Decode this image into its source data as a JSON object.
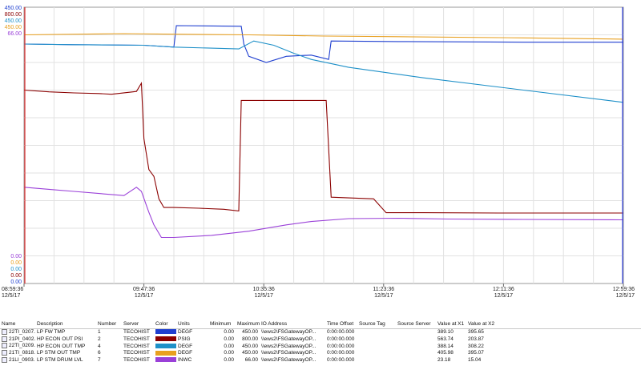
{
  "chart_data": {
    "type": "line",
    "y_axis_labels": [
      {
        "text": "450.00",
        "color": "#1f3fd0",
        "pos": "top"
      },
      {
        "text": "800.00",
        "color": "#8b0000",
        "pos": "top"
      },
      {
        "text": "450.00",
        "color": "#1e90c8",
        "pos": "top"
      },
      {
        "text": "450.00",
        "color": "#e8a020",
        "pos": "top"
      },
      {
        "text": "66.00",
        "color": "#9a40d8",
        "pos": "top"
      },
      {
        "text": "0.00",
        "color": "#9a40d8",
        "pos": "bottom"
      },
      {
        "text": "0.00",
        "color": "#e8a020",
        "pos": "bottom"
      },
      {
        "text": "0.00",
        "color": "#1e90c8",
        "pos": "bottom"
      },
      {
        "text": "0.00",
        "color": "#8b0000",
        "pos": "bottom"
      },
      {
        "text": "0.00",
        "color": "#1f3fd0",
        "pos": "bottom"
      }
    ],
    "x_ticks": [
      {
        "t": 0,
        "time": "08:59:36",
        "date": "12/5/17"
      },
      {
        "t": 48,
        "time": "09:47:36",
        "date": "12/5/17"
      },
      {
        "t": 96,
        "time": "10:35:36",
        "date": "12/5/17"
      },
      {
        "t": 144,
        "time": "11:23:36",
        "date": "12/5/17"
      },
      {
        "t": 192,
        "time": "12:11:36",
        "date": "12/5/17"
      },
      {
        "t": 240,
        "time": "12:59:36",
        "date": "12/5/17"
      }
    ],
    "x_range_minutes": [
      0,
      240
    ],
    "grid": true,
    "series": [
      {
        "tag": "22TI_0207...",
        "color": "#1f3fd0",
        "ymax": 450,
        "points": [
          [
            0,
            390
          ],
          [
            20,
            389
          ],
          [
            48,
            388
          ],
          [
            60,
            385
          ],
          [
            61,
            420
          ],
          [
            87,
            419
          ],
          [
            88,
            390
          ],
          [
            90,
            370
          ],
          [
            97,
            360
          ],
          [
            105,
            370
          ],
          [
            115,
            372
          ],
          [
            122,
            365
          ],
          [
            123,
            395
          ],
          [
            150,
            394
          ],
          [
            200,
            393
          ],
          [
            240,
            393
          ]
        ]
      },
      {
        "tag": "21PI_0402...",
        "color": "#8b0000",
        "ymax": 800,
        "points": [
          [
            0,
            560
          ],
          [
            10,
            555
          ],
          [
            20,
            552
          ],
          [
            30,
            550
          ],
          [
            35,
            548
          ],
          [
            45,
            556
          ],
          [
            47,
            580
          ],
          [
            48,
            420
          ],
          [
            50,
            330
          ],
          [
            52,
            310
          ],
          [
            54,
            245
          ],
          [
            56,
            220
          ],
          [
            60,
            220
          ],
          [
            70,
            218
          ],
          [
            80,
            215
          ],
          [
            86,
            210
          ],
          [
            87,
            530
          ],
          [
            96,
            530
          ],
          [
            110,
            530
          ],
          [
            121,
            530
          ],
          [
            123,
            250
          ],
          [
            140,
            245
          ],
          [
            145,
            205
          ],
          [
            160,
            205
          ],
          [
            190,
            204
          ],
          [
            220,
            204
          ],
          [
            240,
            204
          ]
        ]
      },
      {
        "tag": "22TI_0209...",
        "color": "#1e90c8",
        "ymax": 450,
        "points": [
          [
            0,
            390
          ],
          [
            20,
            389
          ],
          [
            48,
            388
          ],
          [
            60,
            385
          ],
          [
            86,
            382
          ],
          [
            92,
            395
          ],
          [
            100,
            388
          ],
          [
            108,
            375
          ],
          [
            115,
            365
          ],
          [
            130,
            352
          ],
          [
            160,
            335
          ],
          [
            200,
            315
          ],
          [
            240,
            295
          ]
        ]
      },
      {
        "tag": "21TI_0818...",
        "color": "#e8a020",
        "ymax": 450,
        "points": [
          [
            0,
            405
          ],
          [
            40,
            407
          ],
          [
            60,
            406
          ],
          [
            90,
            405
          ],
          [
            120,
            403
          ],
          [
            150,
            402
          ],
          [
            200,
            400
          ],
          [
            240,
            398
          ]
        ]
      },
      {
        "tag": "21LI_0903...",
        "color": "#9a40d8",
        "ymax": 66,
        "points": [
          [
            0,
            23
          ],
          [
            10,
            22.5
          ],
          [
            20,
            22
          ],
          [
            30,
            21.5
          ],
          [
            40,
            21
          ],
          [
            45,
            23
          ],
          [
            47,
            22
          ],
          [
            50,
            17
          ],
          [
            52,
            14
          ],
          [
            55,
            11
          ],
          [
            60,
            11
          ],
          [
            75,
            11.5
          ],
          [
            90,
            12.5
          ],
          [
            105,
            14
          ],
          [
            115,
            14.8
          ],
          [
            130,
            15.5
          ],
          [
            150,
            15.6
          ],
          [
            170,
            15.4
          ],
          [
            200,
            15.3
          ],
          [
            240,
            15.2
          ]
        ]
      }
    ]
  },
  "table": {
    "columns": [
      "Name",
      "Description",
      "Number",
      "Server",
      "Color",
      "Units",
      "Minimum",
      "Maximum",
      "IO Address",
      "Time Offset",
      "Source Tag",
      "Source Server",
      "Value at X1",
      "Value at X2"
    ],
    "rows": [
      {
        "name": "22TI_0207...",
        "desc": "LP FW TMP",
        "num": "1",
        "server": "TECOHIST",
        "color": "#1f3fd0",
        "units": "DEGF",
        "min": "0.00",
        "max": "450.00",
        "io": "\\\\ews2\\FSGatewayOP...",
        "offset": "0:00:00.000",
        "x1": "389.10",
        "x2": "395.65"
      },
      {
        "name": "21PI_0402...",
        "desc": "HP ECON OUT PSI",
        "num": "2",
        "server": "TECOHIST",
        "color": "#8b0000",
        "units": "PSIG",
        "min": "0.00",
        "max": "800.00",
        "io": "\\\\ews2\\FSGatewayOP...",
        "offset": "0:00:00.000",
        "x1": "563.74",
        "x2": "203.87"
      },
      {
        "name": "22TI_0209...",
        "desc": "HP ECON OUT TMP",
        "num": "4",
        "server": "TECOHIST",
        "color": "#1e90c8",
        "units": "DEGF",
        "min": "0.00",
        "max": "450.00",
        "io": "\\\\ews2\\FSGatewayOP...",
        "offset": "0:00:00.000",
        "x1": "388.14",
        "x2": "308.22"
      },
      {
        "name": "21TI_0818...",
        "desc": "LP STM OUT TMP",
        "num": "6",
        "server": "TECOHIST",
        "color": "#e8a020",
        "units": "DEGF",
        "min": "0.00",
        "max": "450.00",
        "io": "\\\\ews2\\FSGatewayOP...",
        "offset": "0:00:00.000",
        "x1": "405.98",
        "x2": "395.07"
      },
      {
        "name": "21LI_0903...",
        "desc": "LP STM DRUM LVL",
        "num": "7",
        "server": "TECOHIST",
        "color": "#9a40d8",
        "units": "INWC",
        "min": "0.00",
        "max": "66.00",
        "io": "\\\\ews2\\FSGatewayOP...",
        "offset": "0:00:00.000",
        "x1": "23.18",
        "x2": "15.04"
      }
    ]
  }
}
